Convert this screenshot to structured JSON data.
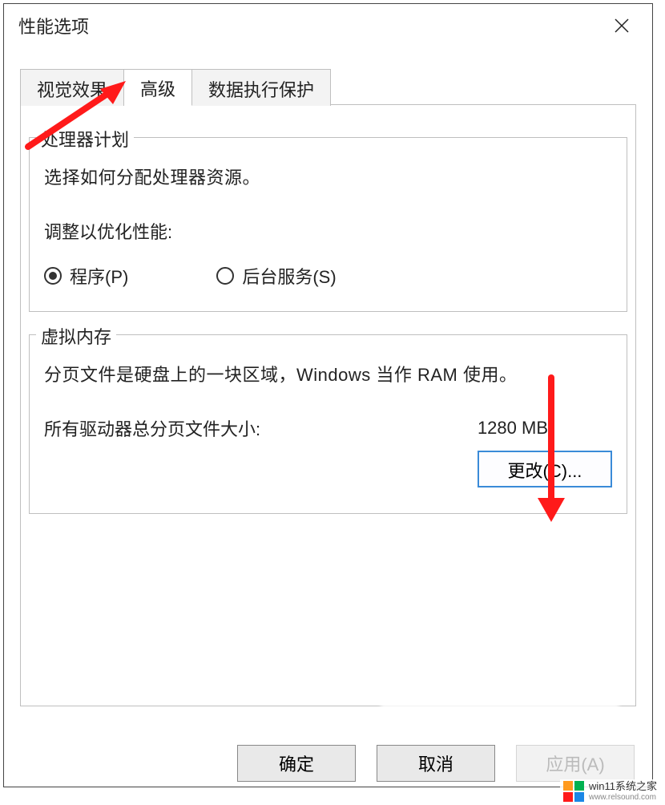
{
  "window": {
    "title": "性能选项"
  },
  "tabs": {
    "visual": "视觉效果",
    "advanced": "高级",
    "dep": "数据执行保护"
  },
  "processor_scheduling": {
    "legend": "处理器计划",
    "desc": "选择如何分配处理器资源。",
    "sub_label": "调整以优化性能:",
    "radio_programs": "程序(P)",
    "radio_background": "后台服务(S)"
  },
  "virtual_memory": {
    "legend": "虚拟内存",
    "desc": "分页文件是硬盘上的一块区域，Windows 当作 RAM 使用。",
    "total_label": "所有驱动器总分页文件大小:",
    "total_value": "1280 MB",
    "change_btn": "更改(C)..."
  },
  "footer": {
    "ok": "确定",
    "cancel": "取消",
    "apply": "应用(A)"
  },
  "watermark": {
    "name": "win11系统之家",
    "url": "www.relsound.com"
  }
}
